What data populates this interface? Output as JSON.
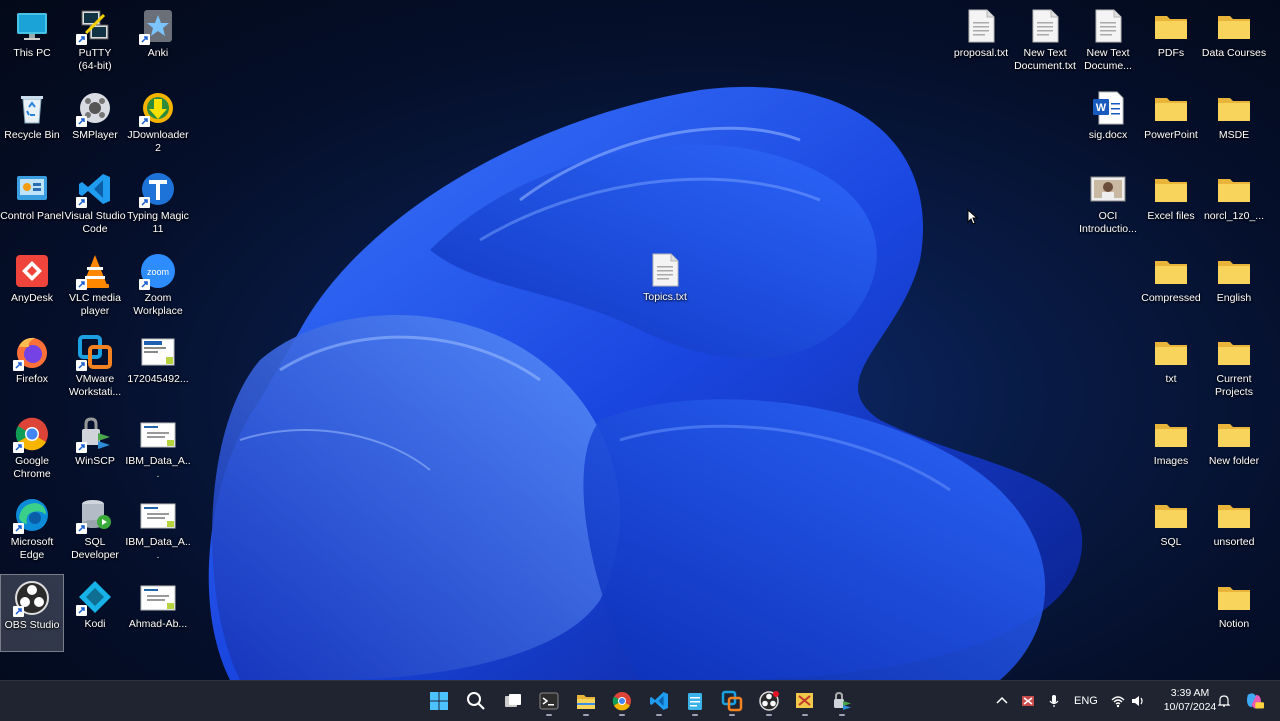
{
  "desktop": {
    "left_icons": [
      {
        "label": "This PC",
        "icon": "monitor-icon"
      },
      {
        "label": "PuTTY\n(64-bit)",
        "icon": "putty-icon"
      },
      {
        "label": "Anki",
        "icon": "anki-icon"
      },
      {
        "label": "Recycle Bin",
        "icon": "recycle-bin-icon"
      },
      {
        "label": "SMPlayer",
        "icon": "smplayer-icon"
      },
      {
        "label": "JDownloader\n2",
        "icon": "jdownloader-icon"
      },
      {
        "label": "Control Panel",
        "icon": "control-panel-icon"
      },
      {
        "label": "Visual Studio\nCode",
        "icon": "vscode-icon"
      },
      {
        "label": "Typing Magic\n11",
        "icon": "typing-magic-icon"
      },
      {
        "label": "AnyDesk",
        "icon": "anydesk-icon"
      },
      {
        "label": "VLC media\nplayer",
        "icon": "vlc-icon"
      },
      {
        "label": "Zoom\nWorkplace",
        "icon": "zoom-icon"
      },
      {
        "label": "Firefox",
        "icon": "firefox-icon"
      },
      {
        "label": "VMware\nWorkstati...",
        "icon": "vmware-icon"
      },
      {
        "label": "172045492...",
        "icon": "image-file-icon"
      },
      {
        "label": "Google\nChrome",
        "icon": "chrome-icon"
      },
      {
        "label": "WinSCP",
        "icon": "winscp-icon"
      },
      {
        "label": "IBM_Data_A...",
        "icon": "certificate-icon"
      },
      {
        "label": "Microsoft\nEdge",
        "icon": "edge-icon"
      },
      {
        "label": "SQL\nDeveloper",
        "icon": "sql-developer-icon"
      },
      {
        "label": "IBM_Data_A...",
        "icon": "certificate-icon"
      },
      {
        "label": "OBS Studio",
        "icon": "obs-icon"
      },
      {
        "label": "Kodi",
        "icon": "kodi-icon"
      },
      {
        "label": "Ahmad-Ab...",
        "icon": "certificate-icon"
      }
    ],
    "center_icon": {
      "label": "Topics.txt",
      "icon": "text-file-icon"
    },
    "right_icons": [
      {
        "label": "proposal.txt",
        "icon": "text-file-icon"
      },
      {
        "label": "New Text\nDocument.txt",
        "icon": "text-file-icon"
      },
      {
        "label": "New Text\nDocume...",
        "icon": "text-file-icon"
      },
      {
        "label": "PDFs",
        "icon": "folder-icon"
      },
      {
        "label": "Data Courses",
        "icon": "folder-icon"
      },
      {
        "label": "sig.docx",
        "icon": "word-doc-icon"
      },
      {
        "label": "PowerPoint",
        "icon": "folder-icon"
      },
      {
        "label": "MSDE",
        "icon": "folder-icon"
      },
      {
        "label": "OCI\nIntroductio...",
        "icon": "video-file-icon"
      },
      {
        "label": "Excel files",
        "icon": "folder-icon"
      },
      {
        "label": "norcl_1z0_...",
        "icon": "folder-icon"
      },
      {
        "label": "Compressed",
        "icon": "folder-icon"
      },
      {
        "label": "English",
        "icon": "folder-icon"
      },
      {
        "label": "txt",
        "icon": "folder-icon"
      },
      {
        "label": "Current\nProjects",
        "icon": "folder-icon"
      },
      {
        "label": "Images",
        "icon": "folder-icon"
      },
      {
        "label": "New folder",
        "icon": "folder-icon"
      },
      {
        "label": "SQL",
        "icon": "folder-icon"
      },
      {
        "label": "unsorted",
        "icon": "folder-icon"
      },
      {
        "label": "Notion",
        "icon": "folder-icon"
      }
    ]
  },
  "taskbar": {
    "apps": [
      "start-icon",
      "search-icon",
      "task-view-icon",
      "terminal-icon",
      "file-explorer-icon",
      "chrome-icon",
      "vscode-icon",
      "notepad-icon",
      "vmware-icon",
      "obs-icon",
      "snipping-tool-icon",
      "winscp-icon"
    ],
    "tray": {
      "language": "ENG",
      "time": "3:39 AM",
      "date": "10/07/2024"
    }
  },
  "colors": {
    "taskbar": "#1f2430",
    "folder": "#f6cf57",
    "accent": "#1f6fe0"
  }
}
